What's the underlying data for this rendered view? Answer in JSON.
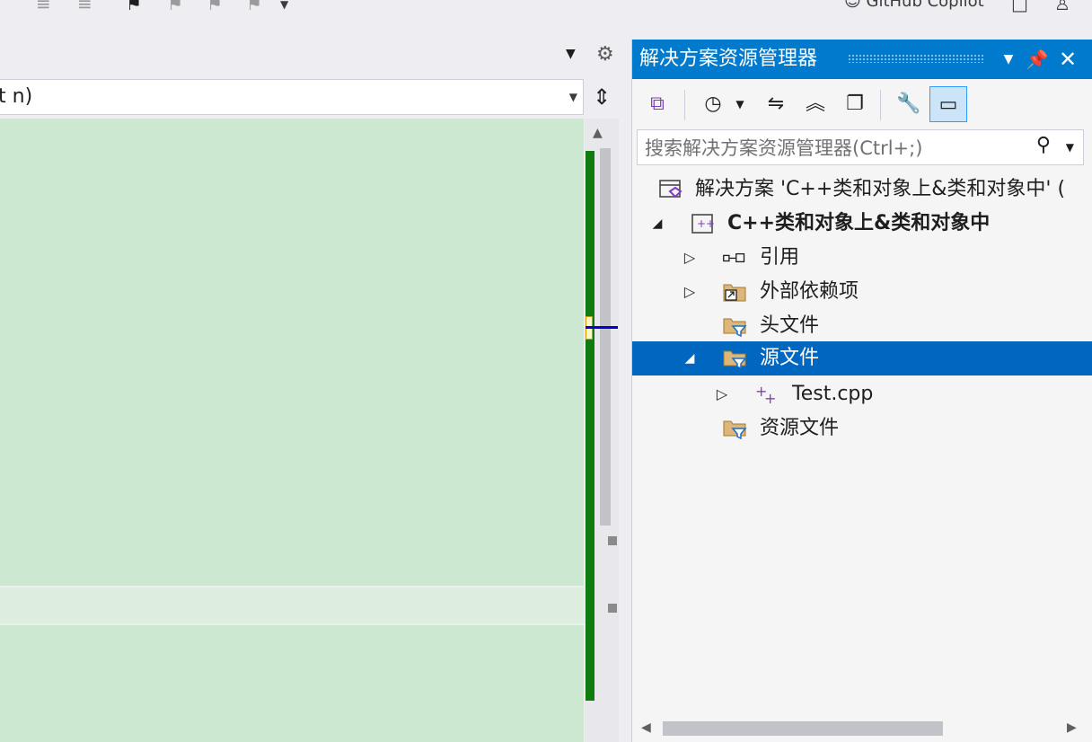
{
  "topbar": {
    "copilot_label": "GitHub Copilot"
  },
  "editor": {
    "nav_combo_text": "t n)",
    "split_icon": "split-icon"
  },
  "solution_explorer": {
    "title": "解决方案资源管理器",
    "search_placeholder": "搜索解决方案资源管理器(Ctrl+;)",
    "tree": {
      "solution": "解决方案 'C++类和对象上&类和对象中' (",
      "project": "C++类和对象上&类和对象中",
      "references": "引用",
      "external_deps": "外部依赖项",
      "header_files": "头文件",
      "source_files": "源文件",
      "test_cpp": "Test.cpp",
      "resource_files": "资源文件"
    }
  },
  "colors": {
    "accent": "#007acc",
    "selection": "#0067c0",
    "editor_bg": "#cde8d0",
    "change_bar": "#107c10"
  }
}
